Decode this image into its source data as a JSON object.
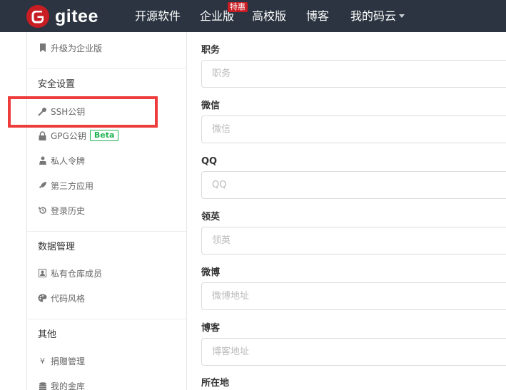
{
  "nav": {
    "logo_text": "gitee",
    "items": [
      "开源软件",
      "企业版",
      "高校版",
      "博客",
      "我的码云"
    ],
    "badge": "特惠"
  },
  "sidebar": {
    "upgrade": "升级为企业版",
    "sections": [
      {
        "title": "安全设置",
        "items": [
          "SSH公钥",
          "GPG公钥",
          "私人令牌",
          "第三方应用",
          "登录历史"
        ]
      },
      {
        "title": "数据管理",
        "items": [
          "私有仓库成员",
          "代码风格"
        ]
      },
      {
        "title": "其他",
        "items": [
          "捐赠管理",
          "我的金库"
        ]
      }
    ],
    "beta_label": "Beta"
  },
  "form": {
    "fields": [
      {
        "label": "职务",
        "placeholder": "职务"
      },
      {
        "label": "微信",
        "placeholder": "微信"
      },
      {
        "label": "QQ",
        "placeholder": "QQ"
      },
      {
        "label": "领英",
        "placeholder": "领英"
      },
      {
        "label": "微博",
        "placeholder": "微博地址"
      },
      {
        "label": "博客",
        "placeholder": "博客地址"
      },
      {
        "label": "所在地",
        "placeholder": ""
      }
    ]
  },
  "colors": {
    "nav_bg": "#2b3440",
    "brand_red": "#c71d23",
    "highlight": "#ee3b3b",
    "beta_green": "#21b351"
  },
  "icons": [
    "gitee-logo-icon",
    "upgrade-icon",
    "key-icon",
    "lock-icon",
    "token-icon",
    "rocket-icon",
    "history-icon",
    "repo-member-icon",
    "palette-icon",
    "yen-icon",
    "coins-icon",
    "caret-down-icon"
  ]
}
